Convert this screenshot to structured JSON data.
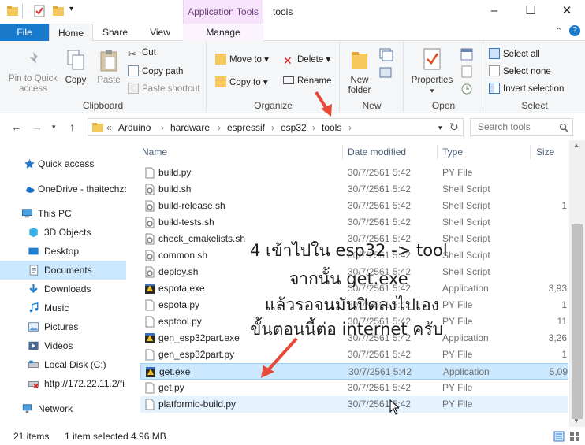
{
  "window": {
    "title": "tools",
    "contextual_tab": "Application Tools",
    "minimize": "–",
    "maximize": "☐",
    "close": "✕"
  },
  "ribbon_tabs": [
    "File",
    "Home",
    "Share",
    "View",
    "Manage"
  ],
  "ribbon": {
    "clipboard": {
      "label": "Clipboard",
      "pin": "Pin to Quick access",
      "copy": "Copy",
      "paste": "Paste",
      "cut": "Cut",
      "copy_path": "Copy path",
      "paste_shortcut": "Paste shortcut"
    },
    "organize": {
      "label": "Organize",
      "move_to": "Move to",
      "copy_to": "Copy to",
      "delete": "Delete",
      "rename": "Rename"
    },
    "new": {
      "label": "New",
      "new_folder": "New folder"
    },
    "open": {
      "label": "Open",
      "properties": "Properties"
    },
    "select": {
      "label": "Select",
      "select_all": "Select all",
      "select_none": "Select none",
      "invert": "Invert selection"
    }
  },
  "address": {
    "overflow": "«",
    "crumbs": [
      "Arduino",
      "hardware",
      "espressif",
      "esp32",
      "tools"
    ],
    "search_placeholder": "Search tools"
  },
  "nav_pane": [
    {
      "label": "Quick access",
      "icon": "star-icon"
    },
    {
      "label": "OneDrive - thaitechzo",
      "icon": "cloud-icon"
    },
    {
      "label": "This PC",
      "icon": "pc-icon"
    },
    {
      "label": "3D Objects",
      "icon": "cube-icon"
    },
    {
      "label": "Desktop",
      "icon": "desktop-icon"
    },
    {
      "label": "Documents",
      "icon": "documents-icon"
    },
    {
      "label": "Downloads",
      "icon": "download-icon"
    },
    {
      "label": "Music",
      "icon": "music-icon"
    },
    {
      "label": "Pictures",
      "icon": "pictures-icon"
    },
    {
      "label": "Videos",
      "icon": "videos-icon"
    },
    {
      "label": "Local Disk (C:)",
      "icon": "disk-icon"
    },
    {
      "label": "http://172.22.11.2/fi",
      "icon": "network-drive-icon"
    },
    {
      "label": "Network",
      "icon": "network-icon"
    }
  ],
  "columns": {
    "name": "Name",
    "date": "Date modified",
    "type": "Type",
    "size": "Size"
  },
  "files": [
    {
      "name": "build.py",
      "date": "30/7/2561 5:42",
      "type": "PY File",
      "size": "",
      "icon": "file-icon"
    },
    {
      "name": "build.sh",
      "date": "30/7/2561 5:42",
      "type": "Shell Script",
      "size": "",
      "icon": "script-icon"
    },
    {
      "name": "build-release.sh",
      "date": "30/7/2561 5:42",
      "type": "Shell Script",
      "size": "1",
      "icon": "script-icon"
    },
    {
      "name": "build-tests.sh",
      "date": "30/7/2561 5:42",
      "type": "Shell Script",
      "size": "",
      "icon": "script-icon"
    },
    {
      "name": "check_cmakelists.sh",
      "date": "30/7/2561 5:42",
      "type": "Shell Script",
      "size": "",
      "icon": "script-icon"
    },
    {
      "name": "common.sh",
      "date": "30/7/2561 5:42",
      "type": "Shell Script",
      "size": "",
      "icon": "script-icon"
    },
    {
      "name": "deploy.sh",
      "date": "30/7/2561 5:42",
      "type": "Shell Script",
      "size": "",
      "icon": "script-icon"
    },
    {
      "name": "espota.exe",
      "date": "30/7/2561 5:42",
      "type": "Application",
      "size": "3,93",
      "icon": "exe-icon"
    },
    {
      "name": "espota.py",
      "date": "30/7/2561 5:42",
      "type": "PY File",
      "size": "1",
      "icon": "file-icon"
    },
    {
      "name": "esptool.py",
      "date": "30/7/2561 5:42",
      "type": "PY File",
      "size": "11",
      "icon": "file-icon"
    },
    {
      "name": "gen_esp32part.exe",
      "date": "30/7/2561 5:42",
      "type": "Application",
      "size": "3,26",
      "icon": "exe-icon"
    },
    {
      "name": "gen_esp32part.py",
      "date": "30/7/2561 5:42",
      "type": "PY File",
      "size": "1",
      "icon": "file-icon"
    },
    {
      "name": "get.exe",
      "date": "30/7/2561 5:42",
      "type": "Application",
      "size": "5,09",
      "icon": "exe-icon"
    },
    {
      "name": "get.py",
      "date": "30/7/2561 5:42",
      "type": "PY File",
      "size": "",
      "icon": "file-icon"
    },
    {
      "name": "platformio-build.py",
      "date": "30/7/2561 5:42",
      "type": "PY File",
      "size": "",
      "icon": "file-icon"
    }
  ],
  "selected_file": "get.exe",
  "status": {
    "items": "21 items",
    "selected": "1 item selected  4.96 MB"
  },
  "annotation": {
    "line1": "4 เข้าไปใน esp32 -> tool",
    "line2": "จากนั้น get.exe",
    "line3": "แล้วรอจนมันปิดลงไปเอง",
    "line4": "ขั้นตอนนี้ต่อ internet ครับ"
  },
  "colors": {
    "accent": "#1979ca",
    "selection": "#cce8ff",
    "arrow": "#e84a3a",
    "contextual": "#f7e3fb"
  }
}
